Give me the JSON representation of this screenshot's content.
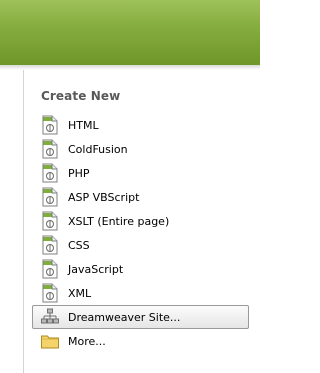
{
  "panel": {
    "title": "Create New",
    "items": [
      {
        "label": "HTML",
        "icon": "file-document-icon"
      },
      {
        "label": "ColdFusion",
        "icon": "file-document-icon"
      },
      {
        "label": "PHP",
        "icon": "file-document-icon"
      },
      {
        "label": "ASP VBScript",
        "icon": "file-document-icon"
      },
      {
        "label": "XSLT (Entire page)",
        "icon": "file-document-icon"
      },
      {
        "label": "CSS",
        "icon": "file-document-icon"
      },
      {
        "label": "JavaScript",
        "icon": "file-document-icon"
      },
      {
        "label": "XML",
        "icon": "file-document-icon"
      },
      {
        "label": "Dreamweaver Site...",
        "icon": "site-hierarchy-icon",
        "selected": true
      },
      {
        "label": "More...",
        "icon": "folder-icon"
      }
    ]
  },
  "colors": {
    "header_green": "#86ad3f",
    "title_gray": "#595959",
    "icon_green": "#7fae3c"
  }
}
